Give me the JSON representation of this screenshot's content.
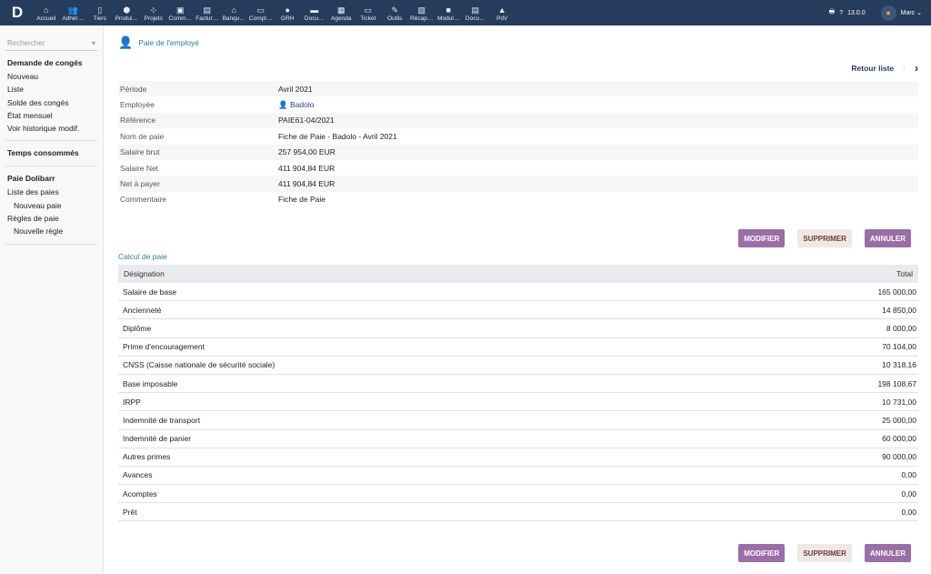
{
  "topbar": {
    "logo": "D",
    "menu": [
      {
        "label": "Accueil",
        "icon": "⌂"
      },
      {
        "label": "Adhér…",
        "icon": "👥"
      },
      {
        "label": "Tiers",
        "icon": "▯"
      },
      {
        "label": "Produi…",
        "icon": "⬢"
      },
      {
        "label": "Projets",
        "icon": "⊹"
      },
      {
        "label": "Comm…",
        "icon": "▣"
      },
      {
        "label": "Factur…",
        "icon": "▤"
      },
      {
        "label": "Banqu…",
        "icon": "⌂"
      },
      {
        "label": "Compt…",
        "icon": "▭"
      },
      {
        "label": "GRH",
        "icon": "●"
      },
      {
        "label": "Docu…",
        "icon": "▬"
      },
      {
        "label": "Agenda",
        "icon": "▦"
      },
      {
        "label": "Ticket",
        "icon": "▭"
      },
      {
        "label": "Outils",
        "icon": "✎"
      },
      {
        "label": "Récap…",
        "icon": "▧"
      },
      {
        "label": "Modul…",
        "icon": "■"
      },
      {
        "label": "Docu…",
        "icon": "▤"
      },
      {
        "label": "PdV",
        "icon": "▲"
      }
    ],
    "version": "13.0.0",
    "user": "Marc"
  },
  "sidebar": {
    "search_placeholder": "Rechercher",
    "blocks": [
      {
        "title": "Demande de congés",
        "items": [
          {
            "label": "Nouveau"
          },
          {
            "label": "Liste"
          },
          {
            "label": "Solde des congés"
          },
          {
            "label": "État mensuel"
          },
          {
            "label": "Voir historique modif."
          }
        ]
      },
      {
        "title": "Temps consommés",
        "items": []
      },
      {
        "title": "Paie Dolibarr",
        "items": [
          {
            "label": "Liste des paies"
          },
          {
            "label": "Nouveau paie",
            "sub": true
          },
          {
            "label": "Règles de paie"
          },
          {
            "label": "Nouvelle règle",
            "sub": true
          }
        ]
      }
    ]
  },
  "main": {
    "title": "Paie de l'employé",
    "back": "Retour liste",
    "fields": [
      {
        "label": "Période",
        "value": "Avril 2021"
      },
      {
        "label": "Employée",
        "value": "Badolo",
        "link": true
      },
      {
        "label": "Référence",
        "value": "PAIE61-04/2021"
      },
      {
        "label": "Nom de paie",
        "value": "Fiche de Paie - Badolo - Avril 2021"
      },
      {
        "label": "Salaire brut",
        "value": "257 954,00 EUR"
      },
      {
        "label": "Salaire Net",
        "value": "411 904,84 EUR"
      },
      {
        "label": "Net à payer",
        "value": "411 904,84 EUR"
      },
      {
        "label": "Commentaire",
        "value": "Fiche de Paie"
      }
    ],
    "buttons": {
      "modify": "MODIFIER",
      "delete": "SUPPRIMER",
      "cancel": "ANNULER"
    },
    "calc_title": "Calcul de paie",
    "table": {
      "headers": [
        "Désignation",
        "Total"
      ],
      "rows": [
        [
          "Salaire de base",
          "165 000,00"
        ],
        [
          "Ancienneté",
          "14 850,00"
        ],
        [
          "Diplôme",
          "8 000,00"
        ],
        [
          "Prime d'encouragement",
          "70 104,00"
        ],
        [
          "CNSS (Caisse nationale de sécurité sociale)",
          "10 318,16"
        ],
        [
          "Base imposable",
          "198 108,67"
        ],
        [
          "IRPP",
          "10 731,00"
        ],
        [
          "Indemnité de transport",
          "25 000,00"
        ],
        [
          "Indemnité de panier",
          "60 000,00"
        ],
        [
          "Autres primes",
          "90 000,00"
        ],
        [
          "Avances",
          "0,00"
        ],
        [
          "Acomptes",
          "0,00"
        ],
        [
          "Prêt",
          "0,00"
        ]
      ]
    }
  }
}
